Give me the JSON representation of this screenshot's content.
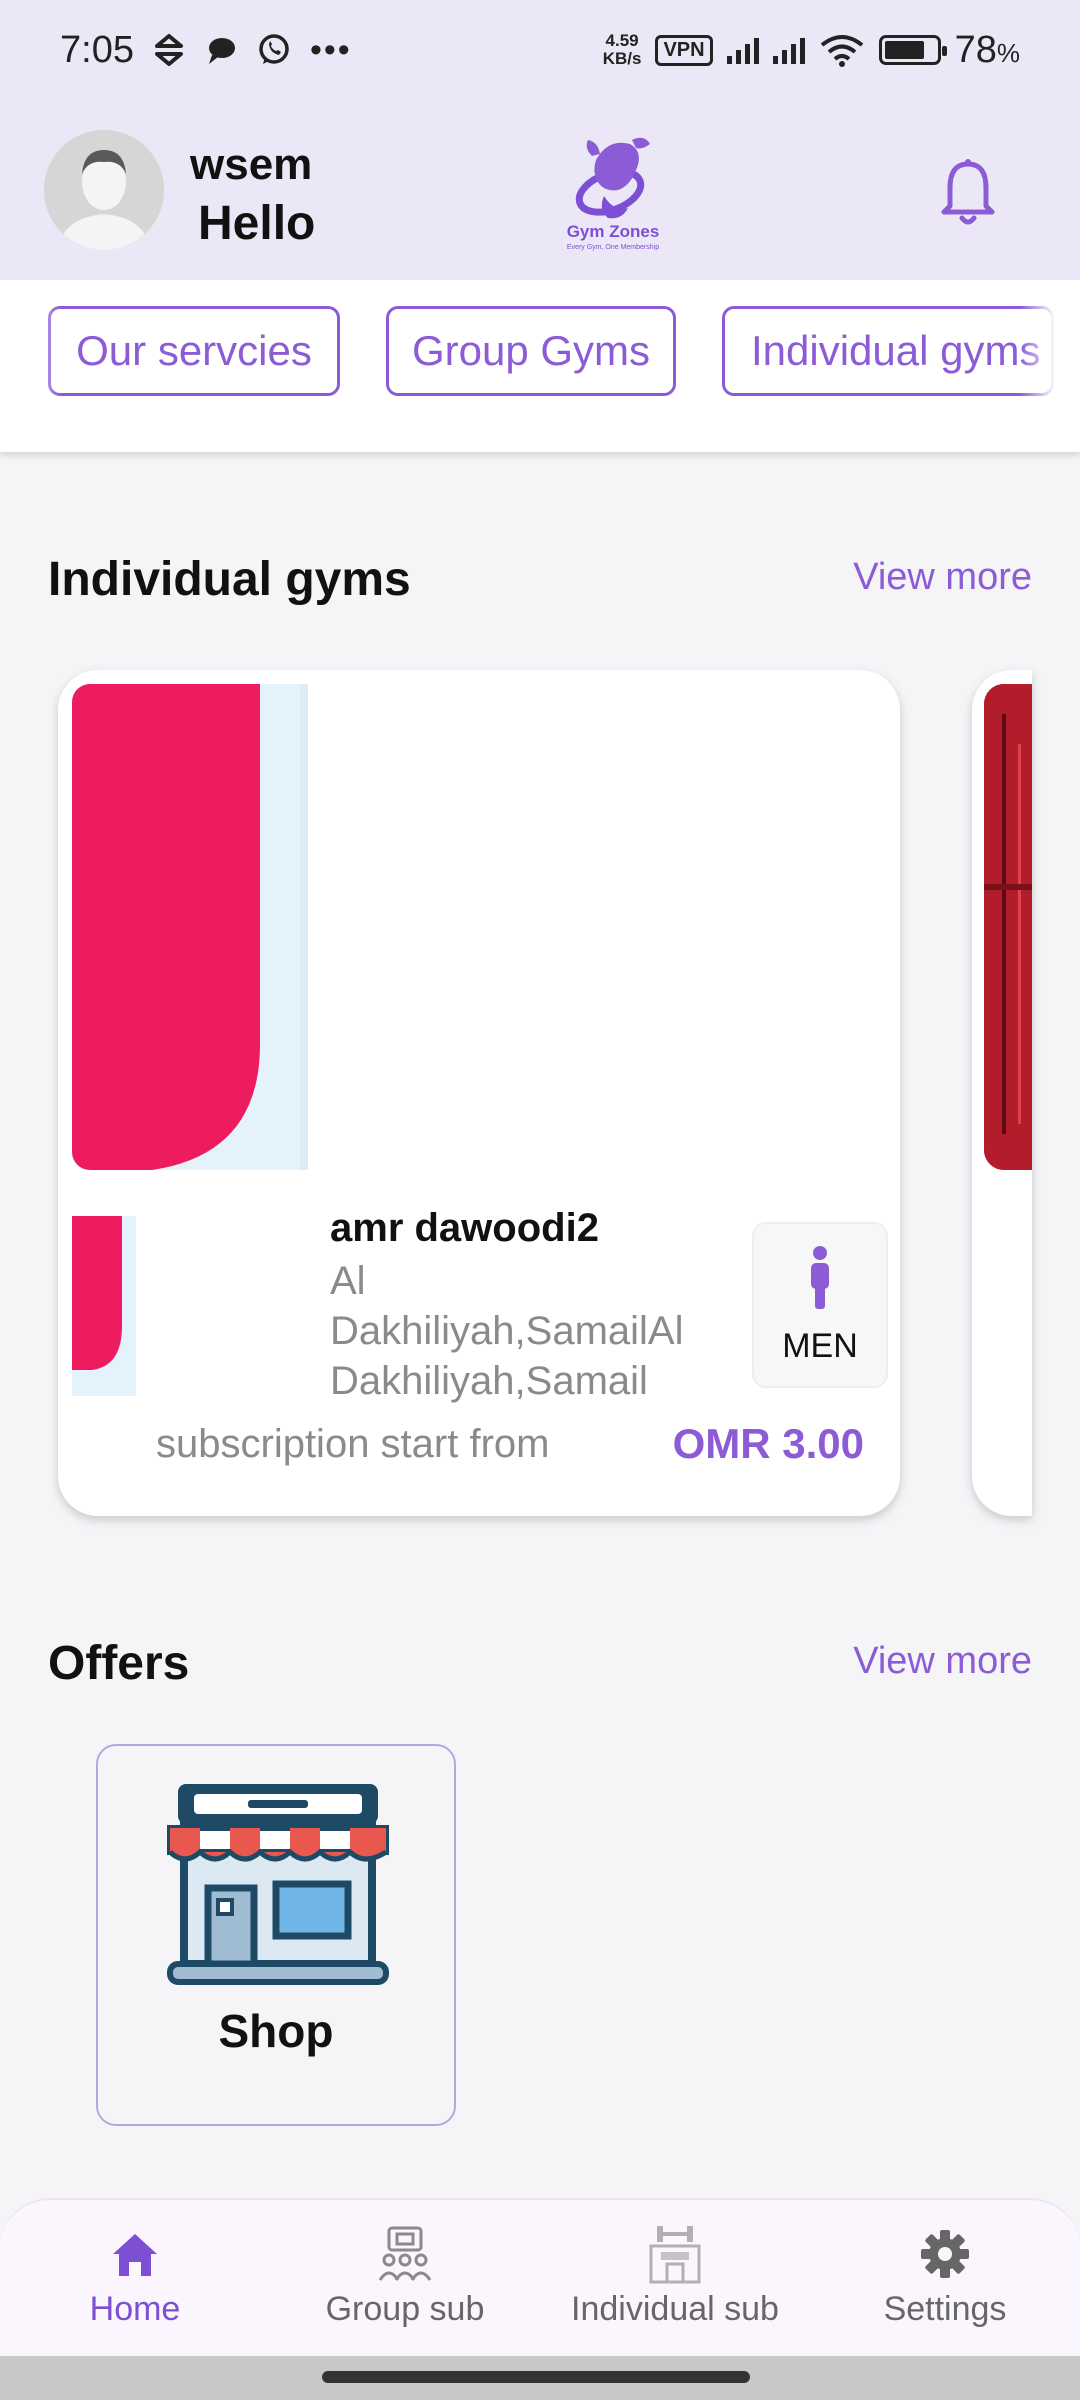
{
  "status_bar": {
    "time": "7:05",
    "net_speed_value": "4.59",
    "net_speed_unit": "KB/s",
    "vpn": "VPN",
    "battery": "78",
    "battery_unit": "%",
    "battery_level": 0.78
  },
  "header": {
    "user_name": "wsem",
    "greeting": "Hello",
    "logo_text": "Gym Zones",
    "logo_tagline": "Every Gym, One Membership"
  },
  "chips": [
    "Our servcies",
    "Group Gyms",
    "Individual gyms"
  ],
  "individual_gyms": {
    "title": "Individual gyms",
    "view_more": "View more",
    "cards": [
      {
        "name": "amr dawoodi2",
        "location_line1": "Al",
        "location_line2": "Dakhiliyah,SamailAl",
        "location_line3": "Dakhiliyah,Samail",
        "gender": "MEN",
        "subscription_label": "subscription start from",
        "price": "OMR 3.00"
      }
    ]
  },
  "offers": {
    "title": "Offers",
    "view_more": "View more",
    "items": [
      {
        "label": "Shop"
      }
    ]
  },
  "bottom_nav": {
    "items": [
      {
        "label": "Home",
        "icon": "home-icon",
        "active": true
      },
      {
        "label": "Group sub",
        "icon": "group-sub-icon",
        "active": false
      },
      {
        "label": "Individual sub",
        "icon": "individual-sub-icon",
        "active": false
      },
      {
        "label": "Settings",
        "icon": "gear-icon",
        "active": false
      }
    ]
  },
  "colors": {
    "accent": "#8b5cd6",
    "header_bg": "#ece7f6",
    "page_bg": "#f5f5f8",
    "active_nav": "#7c4fd4"
  }
}
